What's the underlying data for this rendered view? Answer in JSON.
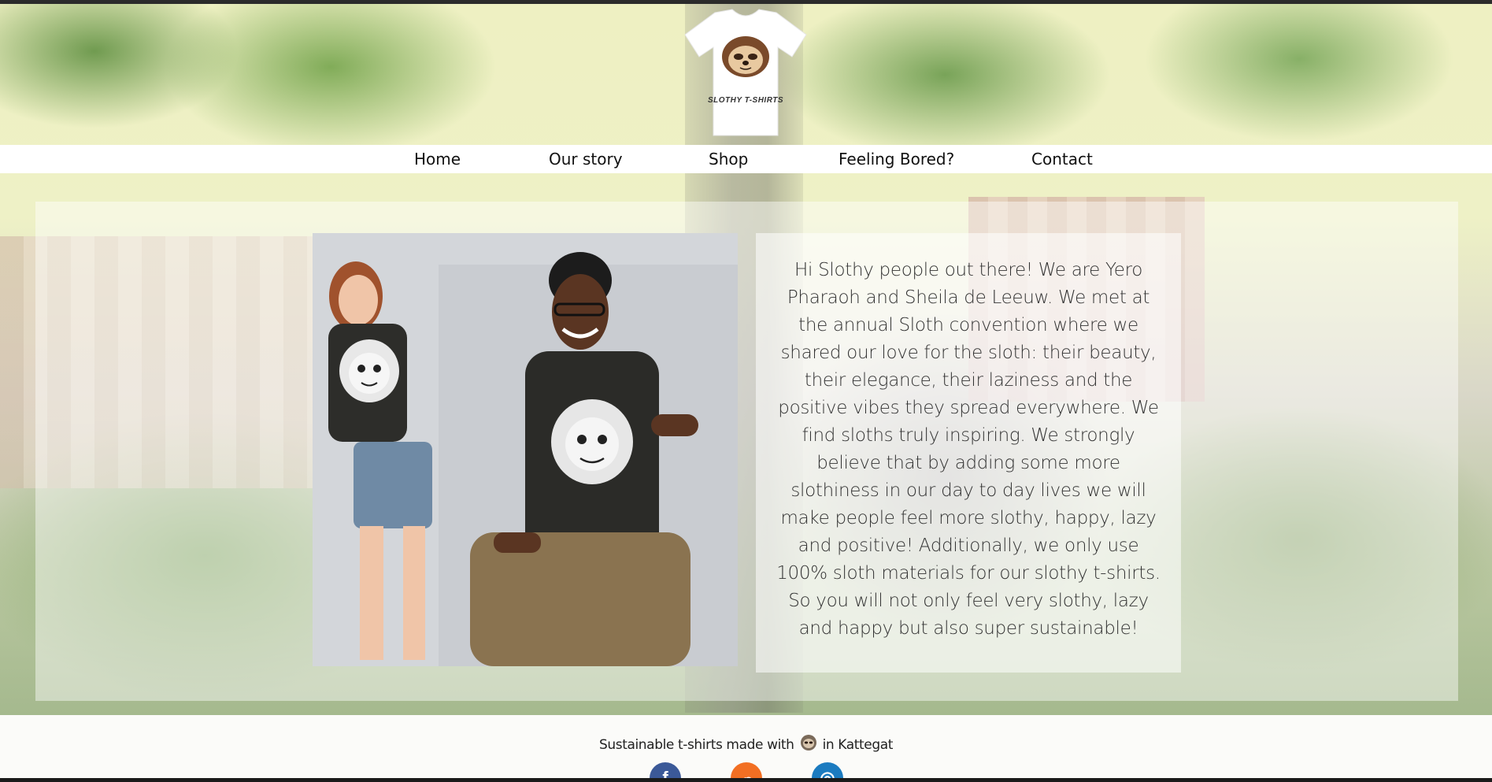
{
  "brand": {
    "logo_text": "SLOTHY T-SHIRTS"
  },
  "nav": {
    "items": [
      {
        "label": "Home"
      },
      {
        "label": "Our story"
      },
      {
        "label": "Shop"
      },
      {
        "label": "Feeling Bored?"
      },
      {
        "label": "Contact"
      }
    ]
  },
  "main": {
    "photo_alt": "Two people wearing sloth t-shirts",
    "story_text": "Hi Slothy people out there! We are Yero Pharaoh and Sheila de Leeuw. We met at the annual Sloth convention where we shared our love for the sloth: their beauty, their elegance, their laziness and the positive vibes they spread everywhere. We find sloths truly inspiring. We strongly believe that by adding some more slothiness in our day to day lives we will make people feel more slothy, happy, lazy and positive! Additionally, we only use 100% sloth materials for our slothy t-shirts. So you will not only feel very slothy, lazy and happy but also super sustainable!"
  },
  "footer": {
    "text_before": "Sustainable t-shirts made with",
    "text_after": "in Kattegat",
    "social": [
      {
        "name": "facebook",
        "glyph": "f",
        "color": "#3b5998"
      },
      {
        "name": "soundcloud",
        "glyph": "☁",
        "color": "#f26f23"
      },
      {
        "name": "instagram",
        "glyph": "◎",
        "color": "#1b7bc0"
      }
    ]
  },
  "colors": {
    "nav_background": "#ffffff",
    "text": "#333333",
    "footer_background": "#fbfbf9"
  }
}
